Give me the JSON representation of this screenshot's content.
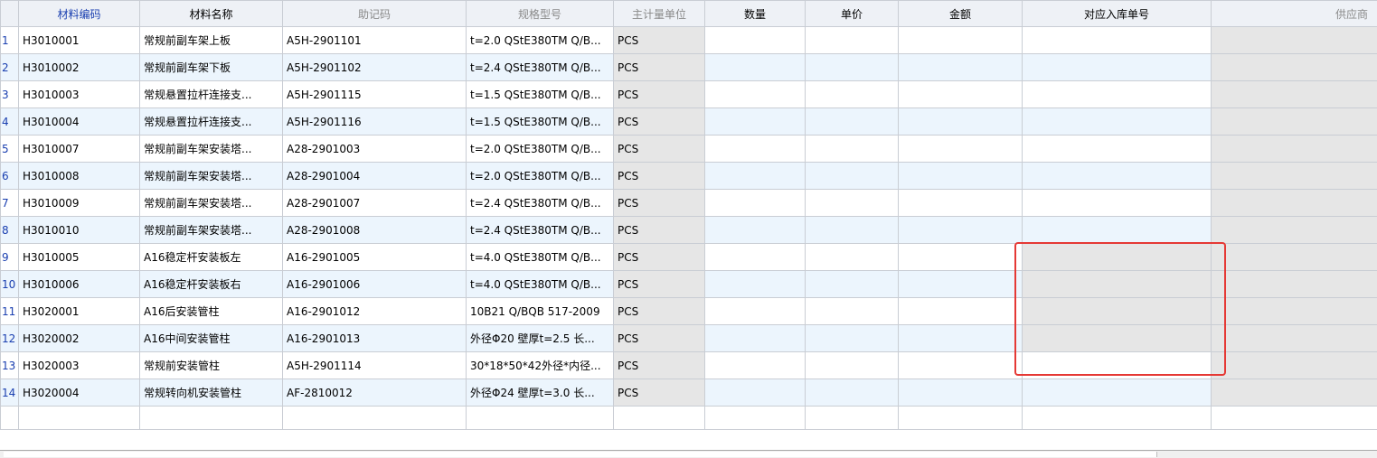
{
  "columns": [
    "材料编码",
    "材料名称",
    "助记码",
    "规格型号",
    "主计量单位",
    "数量",
    "单价",
    "金额",
    "对应入库单号",
    "供应商"
  ],
  "rows": [
    {
      "idx": "1",
      "code": "H3010001",
      "name": "常规前副车架上板",
      "mnemonic": "A5H-2901101",
      "spec": "t=2.0 QStE380TM Q/B...",
      "unit": "PCS"
    },
    {
      "idx": "2",
      "code": "H3010002",
      "name": "常规前副车架下板",
      "mnemonic": "A5H-2901102",
      "spec": "t=2.4 QStE380TM Q/B...",
      "unit": "PCS"
    },
    {
      "idx": "3",
      "code": "H3010003",
      "name": "常规悬置拉杆连接支...",
      "mnemonic": "A5H-2901115",
      "spec": "t=1.5 QStE380TM Q/B...",
      "unit": "PCS"
    },
    {
      "idx": "4",
      "code": "H3010004",
      "name": "常规悬置拉杆连接支...",
      "mnemonic": "A5H-2901116",
      "spec": "t=1.5 QStE380TM Q/B...",
      "unit": "PCS"
    },
    {
      "idx": "5",
      "code": "H3010007",
      "name": "常规前副车架安装塔...",
      "mnemonic": "A28-2901003",
      "spec": "t=2.0 QStE380TM Q/B...",
      "unit": "PCS"
    },
    {
      "idx": "6",
      "code": "H3010008",
      "name": "常规前副车架安装塔...",
      "mnemonic": "A28-2901004",
      "spec": "t=2.0 QStE380TM Q/B...",
      "unit": "PCS"
    },
    {
      "idx": "7",
      "code": "H3010009",
      "name": "常规前副车架安装塔...",
      "mnemonic": "A28-2901007",
      "spec": "t=2.4 QStE380TM Q/B...",
      "unit": "PCS"
    },
    {
      "idx": "8",
      "code": "H3010010",
      "name": "常规前副车架安装塔...",
      "mnemonic": "A28-2901008",
      "spec": "t=2.4 QStE380TM Q/B...",
      "unit": "PCS"
    },
    {
      "idx": "9",
      "code": "H3010005",
      "name": "A16稳定杆安装板左",
      "mnemonic": "A16-2901005",
      "spec": "t=4.0 QStE380TM Q/B...",
      "unit": "PCS"
    },
    {
      "idx": "10",
      "code": "H3010006",
      "name": "A16稳定杆安装板右",
      "mnemonic": "A16-2901006",
      "spec": "t=4.0 QStE380TM Q/B...",
      "unit": "PCS"
    },
    {
      "idx": "11",
      "code": "H3020001",
      "name": "A16后安装管柱",
      "mnemonic": "A16-2901012",
      "spec": "10B21 Q/BQB 517-2009",
      "unit": "PCS"
    },
    {
      "idx": "12",
      "code": "H3020002",
      "name": "A16中间安装管柱",
      "mnemonic": "A16-2901013",
      "spec": "外径Φ20 壁厚t=2.5 长...",
      "unit": "PCS"
    },
    {
      "idx": "13",
      "code": "H3020003",
      "name": "常规前安装管柱",
      "mnemonic": "A5H-2901114",
      "spec": "30*18*50*42外径*内径...",
      "unit": "PCS"
    },
    {
      "idx": "14",
      "code": "H3020004",
      "name": "常规转向机安装管柱",
      "mnemonic": "AF-2810012",
      "spec": "外径Φ24 壁厚t=3.0 长...",
      "unit": "PCS"
    }
  ]
}
